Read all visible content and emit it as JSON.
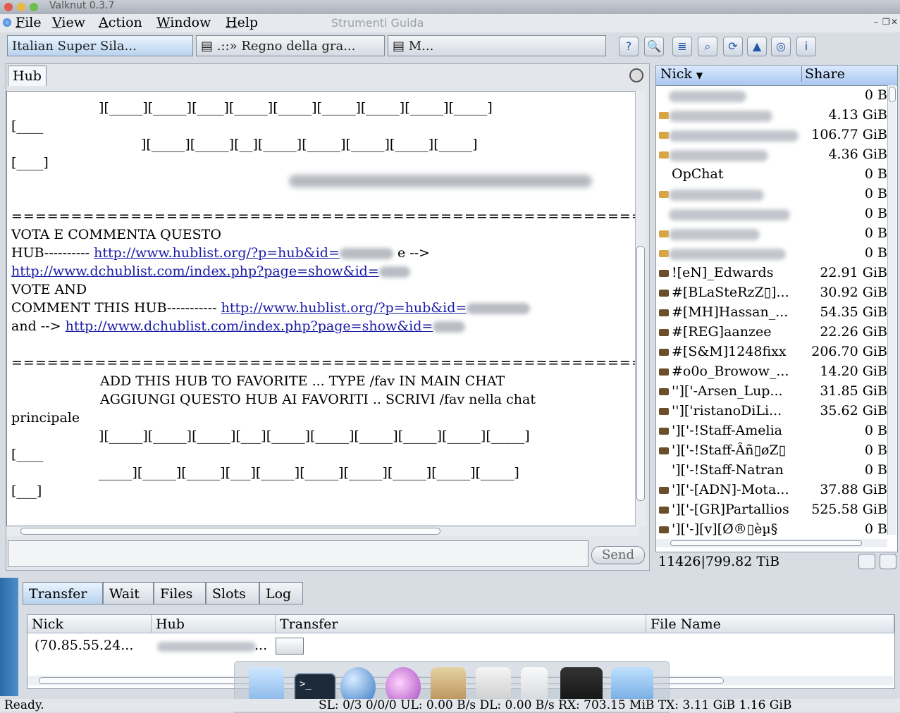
{
  "window": {
    "title": "Valknut 0.3.7"
  },
  "menubar": {
    "items": [
      {
        "label": "File",
        "key": "F",
        "rest": "ile"
      },
      {
        "label": "View",
        "key": "V",
        "rest": "iew"
      },
      {
        "label": "Action",
        "key": "A",
        "rest": "ction"
      },
      {
        "label": "Window",
        "key": "W",
        "rest": "indow"
      },
      {
        "label": "Help",
        "key": "H",
        "rest": "elp"
      }
    ],
    "ghost": "Strumenti  Guida"
  },
  "hub_tabs": [
    {
      "label": "Italian Super Sila...",
      "active": true
    },
    {
      "label": ".::» Regno della gra...",
      "active": false
    },
    {
      "label": "M...",
      "active": false
    }
  ],
  "toolbar": {
    "icons": [
      "help-icon",
      "search-tool-icon",
      "stack-icon",
      "find-icon",
      "reconnect-icon",
      "hub-list-icon",
      "target-icon",
      "info-icon"
    ]
  },
  "hub": {
    "label": "Hub",
    "chat_lines": [
      "][_____][_____][____][_____][_____][_____][_____][_____][_____]",
      "[____",
      "][_____][_____][__][_____][_____][_____][_____][_____]",
      "[____]",
      "===========================================================",
      "VOTA E COMMENTA  QUESTO",
      "HUB----------",
      "e   -->",
      "VOTE AND",
      "COMMENT  THIS  HUB-----------",
      "and -->",
      "===========================================================",
      "ADD THIS HUB TO FAVORITE ... TYPE      /fav      IN MAIN CHAT",
      "AGGIUNGI QUESTO HUB AI FAVORITI .. SCRIVI   /fav     nella chat",
      "principale",
      "][_____][_____][_____][___][_____][_____][_____][_____][_____][_____]",
      "[____",
      "_____][_____][_____][___][_____][_____][_____][_____][_____][_____]",
      "[___]"
    ],
    "links": {
      "hublist_1": "http://www.hublist.org/?p=hub&id=",
      "dchublist_1": "http://www.dchublist.com/index.php?page=show&id=",
      "hublist_2": "http://www.hublist.org/?p=hub&id=",
      "dchublist_2": "http://www.dchublist.com/index.php?page=show&id="
    },
    "send_label": "Send"
  },
  "userlist": {
    "headers": {
      "nick": "Nick",
      "share": "Share"
    },
    "rows": [
      {
        "nick": "",
        "share": "0 B",
        "icon": "none",
        "blurred": true
      },
      {
        "nick": "",
        "share": "4.13 GiB",
        "icon": "key-icon",
        "blurred": true
      },
      {
        "nick": "",
        "share": "106.77 GiB",
        "icon": "key-icon",
        "blurred": true
      },
      {
        "nick": "",
        "share": "4.36 GiB",
        "icon": "key-icon",
        "blurred": true
      },
      {
        "nick": "OpChat",
        "share": "0 B",
        "icon": "none",
        "blurred": false
      },
      {
        "nick": "",
        "share": "0 B",
        "icon": "key-icon",
        "blurred": true
      },
      {
        "nick": "",
        "share": "0 B",
        "icon": "none",
        "blurred": true
      },
      {
        "nick": "",
        "share": "0 B",
        "icon": "key-icon",
        "blurred": true
      },
      {
        "nick": "",
        "share": "0 B",
        "icon": "key-icon",
        "blurred": true
      },
      {
        "nick": "![eN]_Edwards",
        "share": "22.91 GiB",
        "icon": "modem-icon",
        "blurred": false
      },
      {
        "nick": "#[BLaSteRzZ▯]...",
        "share": "30.92 GiB",
        "icon": "modem-icon",
        "blurred": false
      },
      {
        "nick": "#[MH]Hassan_...",
        "share": "54.35 GiB",
        "icon": "modem-icon",
        "blurred": false
      },
      {
        "nick": "#[REG]aanzee",
        "share": "22.26 GiB",
        "icon": "modem-icon",
        "blurred": false
      },
      {
        "nick": "#[S&M]1248fixx",
        "share": "206.70 GiB",
        "icon": "modem-icon",
        "blurred": false
      },
      {
        "nick": "#o0o_Browow_...",
        "share": "14.20 GiB",
        "icon": "modem-icon",
        "blurred": false
      },
      {
        "nick": "'']['-Arsen_Lup...",
        "share": "31.85 GiB",
        "icon": "modem-icon",
        "blurred": false
      },
      {
        "nick": "'']['ristanoDiLi...",
        "share": "35.62 GiB",
        "icon": "modem-icon",
        "blurred": false
      },
      {
        "nick": "']['-!Staff-Amelia",
        "share": "0 B",
        "icon": "modem-icon",
        "blurred": false
      },
      {
        "nick": "']['-!Staff-Âñ▯øZ▯",
        "share": "0 B",
        "icon": "modem-icon",
        "blurred": false
      },
      {
        "nick": "']['-!Staff-Natran",
        "share": "0 B",
        "icon": "none",
        "blurred": false
      },
      {
        "nick": "']['-[ADN]-Mota...",
        "share": "37.88 GiB",
        "icon": "modem-icon",
        "blurred": false
      },
      {
        "nick": "']['-[GR]Partallios",
        "share": "525.58 GiB",
        "icon": "modem-icon",
        "blurred": false
      },
      {
        "nick": "']['-][v][Ø®▯èµ§",
        "share": "0 B",
        "icon": "modem-icon",
        "blurred": false
      }
    ],
    "summary": {
      "count": "11426",
      "total": "799.82 TiB"
    }
  },
  "transfers": {
    "tabs": [
      "Transfer",
      "Wait",
      "Files",
      "Slots",
      "Log"
    ],
    "headers": {
      "nick": "Nick",
      "hub": "Hub",
      "transfer": "Transfer",
      "file": "File Name"
    },
    "rows": [
      {
        "nick": "(70.85.55.24...",
        "hub": "..."
      }
    ]
  },
  "statusbar": {
    "left": "Ready.",
    "right": "SL: 0/3 0/0/0 UL: 0.00 B/s DL: 0.00 B/s RX: 703.15 MiB TX: 3.11 GiB 1.16 GiB"
  }
}
